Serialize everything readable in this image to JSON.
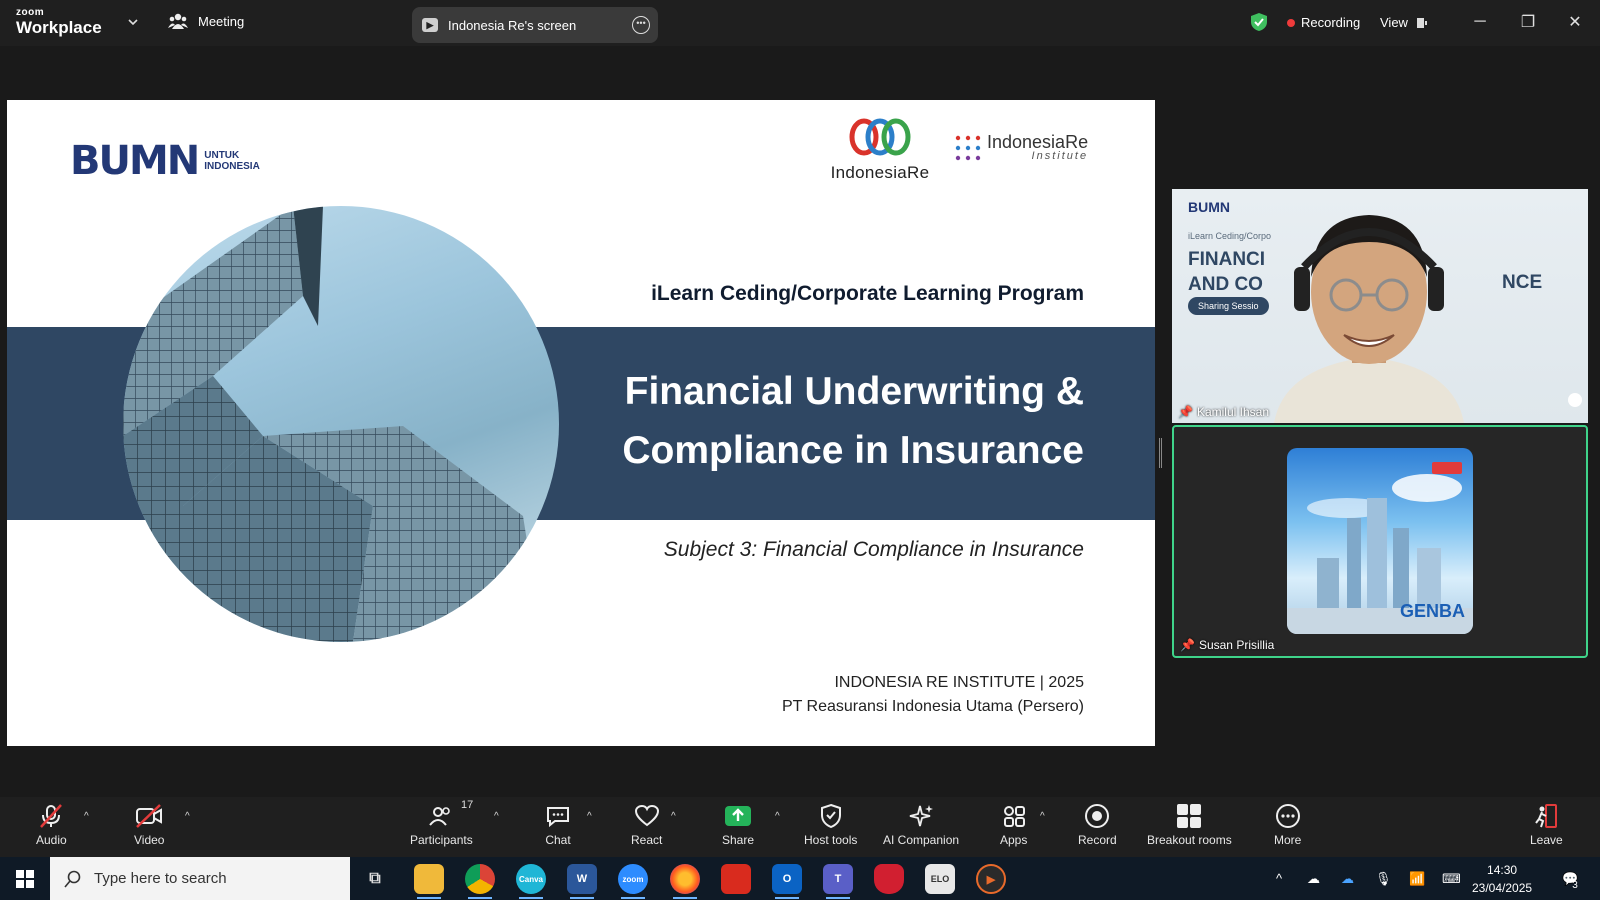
{
  "titlebar": {
    "brand_small": "zoom",
    "brand_big": "Workplace",
    "meeting_label": "Meeting",
    "screen_share_label": "Indonesia Re's screen",
    "recording_label": "Recording",
    "view_label": "View",
    "status_color": "#3fbf5f",
    "record_color": "#ef3b3b"
  },
  "slide": {
    "brand_bumn": "BUMN",
    "brand_bumn_tag_line1": "UNTUK",
    "brand_bumn_tag_line2": "INDONESIA",
    "brand_indonesiare": "IndonesiaRe",
    "brand_institute_main": "IndonesiaRe",
    "brand_institute_sub": "Institute",
    "program": "iLearn Ceding/Corporate Learning Program",
    "title_line1": "Financial Underwriting &",
    "title_line2": "Compliance in Insurance",
    "subject": "Subject 3: Financial Compliance in Insurance",
    "footer_line1": "INDONESIA RE INSTITUTE | 2025",
    "footer_line2": "PT Reasuransi Indonesia Utama (Persero)",
    "band_color": "#2f4763"
  },
  "participants": [
    {
      "name": "Kamilul Ihsan",
      "bg_brand": "BUMN",
      "bg_text_line1": "FINANCI",
      "bg_text_line2": "AND CO",
      "bg_text_line3": "NCE",
      "bg_small_text": "iLearn Ceding/Corpo",
      "bg_pill": "Sharing Sessio"
    },
    {
      "name": "Susan Prisillia",
      "avatar_text": "GENBA",
      "highlight_color": "#3fd48a"
    }
  ],
  "toolbar": {
    "audio": "Audio",
    "video": "Video",
    "participants": "Participants",
    "participants_count": "17",
    "chat": "Chat",
    "react": "React",
    "share": "Share",
    "host_tools": "Host tools",
    "ai_companion": "AI Companion",
    "apps": "Apps",
    "record": "Record",
    "breakout_rooms": "Breakout rooms",
    "more": "More",
    "leave": "Leave",
    "share_color": "#24b35a"
  },
  "taskbar": {
    "search_placeholder": "Type here to search",
    "apps": [
      "file-explorer",
      "chrome",
      "canva",
      "word",
      "zoom",
      "firefox",
      "acrobat",
      "outlook",
      "teams",
      "security",
      "elo",
      "media-player"
    ],
    "canva_label": "Canva",
    "word_label": "W",
    "zoom_label": "zoom",
    "outlook_label": "O",
    "teams_label": "T",
    "elo_label": "ELO",
    "time": "14:30",
    "date": "23/04/2025",
    "notification_count": "3"
  }
}
